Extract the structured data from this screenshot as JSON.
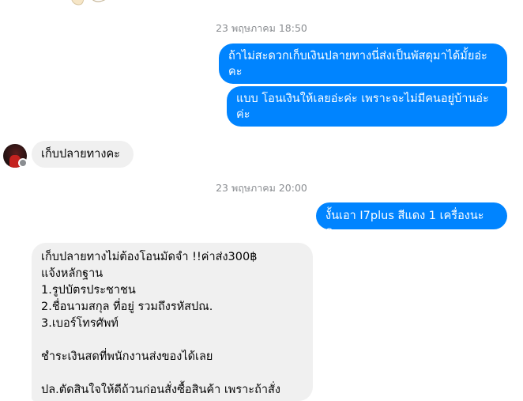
{
  "messages": {
    "timestamp_1": "23 พฤษภาคม 18:50",
    "out_1": "ถ้าไม่สะดวกเก็บเงินปลายทางนี่ส่งเป็นพัสดุมาได้มั้ยอ่ะคะ",
    "out_2": "แบบ โอนเงินให้เลยอ่ะค่ะ เพราะจะไม่มีคนอยู่บ้านอ่ะค่ะ",
    "in_1": "เก็บปลายทางคะ",
    "timestamp_2": "23 พฤษภาคม 20:00",
    "out_3": "งั้นเอา I7plus สีแดง 1 เครื่องนะคะ",
    "in_2": "เก็บปลายทางไม่ต้องโอนมัดจำ !!ค่าส่ง300฿\nแจ้งหลักฐาน\n1.รูปบัตรประชาชน\n2.ชื่อนามสกุล ที่อยู่ รวมถึงรหัสปณ.\n3.เบอร์โทรศัพท์\n\nชำระเงินสดที่พนักงานส่งของได้เลย\n\nปล.ตัดสินใจให้ดีถ้วนก่อนสั่งซื้อสินค้า เพราะถ้าสั่ง"
  },
  "colors": {
    "outgoing_bubble": "#0084ff",
    "incoming_bubble": "#f0f0f0",
    "timestamp_text": "#8a8d91"
  }
}
